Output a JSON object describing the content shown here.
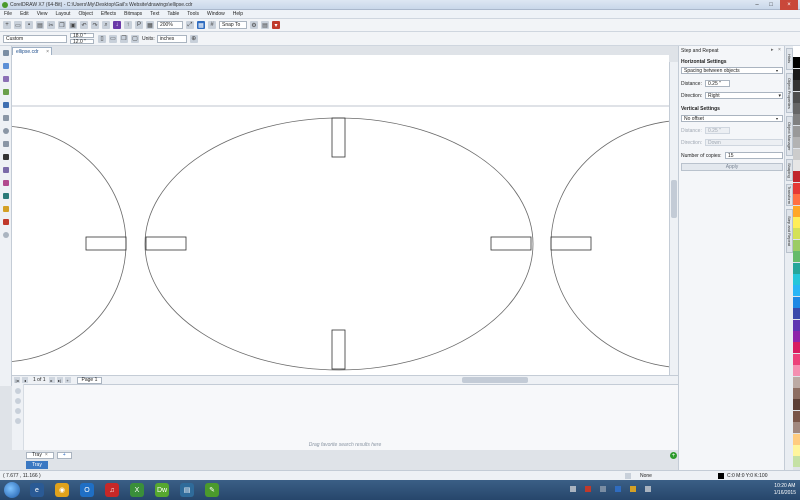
{
  "window": {
    "title": "CorelDRAW X7 (64-Bit) - C:\\Users\\My\\Desktop\\Gail's Website\\drawings\\ellipse.cdr"
  },
  "menu": [
    "File",
    "Edit",
    "View",
    "Layout",
    "Object",
    "Effects",
    "Bitmaps",
    "Text",
    "Table",
    "Tools",
    "Window",
    "Help"
  ],
  "toolbar": {
    "zoom": "200%",
    "snap": "Snap To"
  },
  "propbar": {
    "preset": "Custom",
    "width": "18.0 \"",
    "height": "12.0 \"",
    "units_label": "Units:",
    "units_value": "inches"
  },
  "document": {
    "tab": "ellipse.cdr"
  },
  "pages": {
    "count": "1 of 1",
    "page_tab": "Page 1"
  },
  "tray": {
    "hint": "Drag favorite search results here",
    "tab": "Tray",
    "bottom_tab": "Tray"
  },
  "panel": {
    "title": "Step and Repeat",
    "horizontal": {
      "heading": "Horizontal Settings",
      "mode": "Spacing between objects",
      "distance_label": "Distance:",
      "distance": "0.25 \"",
      "direction_label": "Direction:",
      "direction": "Right"
    },
    "vertical": {
      "heading": "Vertical Settings",
      "mode": "No offset",
      "distance_label": "Distance:",
      "distance": "0.25 \"",
      "direction_label": "Direction:",
      "direction": "Down"
    },
    "copies_label": "Number of copies:",
    "copies": "15",
    "apply": "Apply"
  },
  "dockers": [
    "Hints",
    "Object Properties",
    "Object Manager",
    "Shaping",
    "Transform",
    "Step and Repeat"
  ],
  "palette_colors": [
    "#ffffff",
    "#000000",
    "#1a1a1a",
    "#333333",
    "#4d4d4d",
    "#666666",
    "#808080",
    "#999999",
    "#b3b3b3",
    "#cccccc",
    "#e6e6e6",
    "#c1272d",
    "#e53935",
    "#ff7043",
    "#ffa726",
    "#ffee58",
    "#d4e157",
    "#9ccc65",
    "#66bb6a",
    "#26a69a",
    "#26c6da",
    "#29b6f6",
    "#1e88e5",
    "#3949ab",
    "#5e35b1",
    "#8e24aa",
    "#d81b60",
    "#ec407a",
    "#f48fb1",
    "#bcaaa4",
    "#8d6e63",
    "#5d4037",
    "#795548",
    "#a1887f",
    "#ffcc80",
    "#fff59d",
    "#c5e1a5"
  ],
  "status": {
    "coords": "( 7.677 , 11.166 )",
    "fill": "None",
    "outline": "C:0 M:0 Y:0 K:100"
  },
  "taskbar": {
    "time": "10:20 AM",
    "date": "1/16/2015"
  }
}
